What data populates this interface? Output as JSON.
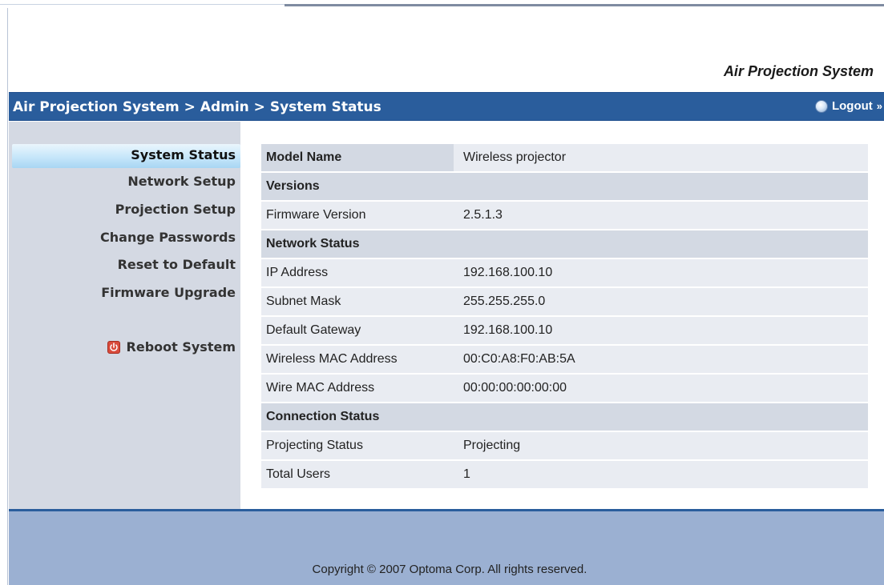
{
  "header": {
    "brand": "Air Projection System",
    "breadcrumb": "Air Projection System > Admin > System Status",
    "logout_label": "Logout",
    "logout_arrow": "»"
  },
  "sidebar": {
    "active_item": "System Status",
    "items": [
      {
        "label": "Network Setup"
      },
      {
        "label": "Projection Setup"
      },
      {
        "label": "Change Passwords"
      },
      {
        "label": "Reset to Default"
      },
      {
        "label": "Firmware Upgrade"
      }
    ],
    "reboot_label": "Reboot System"
  },
  "status": {
    "model_name_label": "Model Name",
    "model_name_value": "Wireless projector",
    "versions_header": "Versions",
    "firmware_label": "Firmware Version",
    "firmware_value": "2.5.1.3",
    "network_header": "Network Status",
    "ip_label": "IP Address",
    "ip_value": "192.168.100.10",
    "subnet_label": "Subnet Mask",
    "subnet_value": "255.255.255.0",
    "gateway_label": "Default Gateway",
    "gateway_value": "192.168.100.10",
    "wireless_mac_label": "Wireless MAC Address",
    "wireless_mac_value": "00:C0:A8:F0:AB:5A",
    "wire_mac_label": "Wire MAC Address",
    "wire_mac_value": "00:00:00:00:00:00",
    "connection_header": "Connection Status",
    "projecting_label": "Projecting Status",
    "projecting_value": "Projecting",
    "users_label": "Total Users",
    "users_value": "1"
  },
  "footer": {
    "copyright": "Copyright © 2007 Optoma Corp. All rights reserved."
  },
  "colors": {
    "titlebar": "#2a5d9c",
    "sidebar": "#d4d9e3",
    "footer": "#9bb0d2",
    "row": "#e9ecf2",
    "section_row": "#d3d9e3"
  }
}
